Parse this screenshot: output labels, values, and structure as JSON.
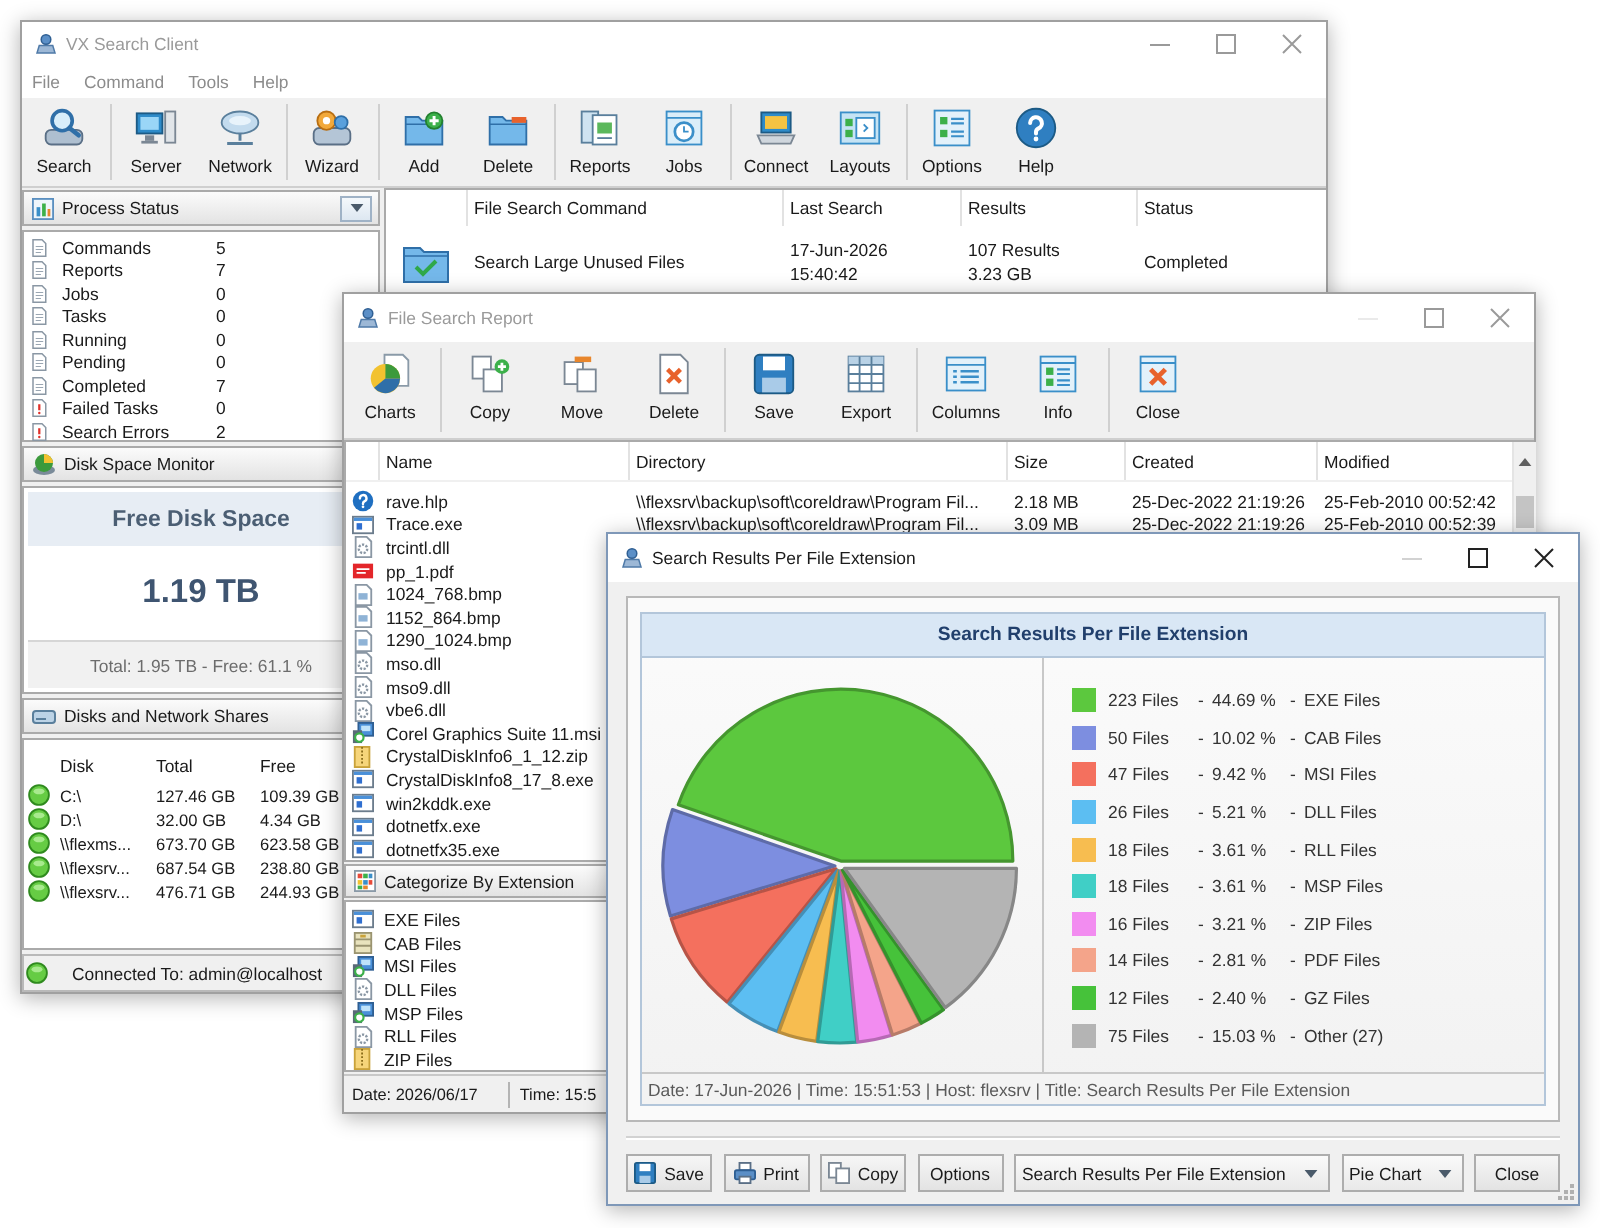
{
  "main_window": {
    "title": "VX Search Client",
    "active": false,
    "minimize_enabled": true,
    "menu": [
      "File",
      "Command",
      "Tools",
      "Help"
    ],
    "toolbar": [
      [
        "Search"
      ],
      [
        "Server",
        "Network"
      ],
      [
        "Wizard"
      ],
      [
        "Add",
        "Delete"
      ],
      [
        "Reports",
        "Jobs"
      ],
      [
        "Connect",
        "Layouts"
      ],
      [
        "Options",
        "Help"
      ]
    ],
    "process_status": {
      "title": "Process Status",
      "items": [
        {
          "kind": "normal",
          "label": "Commands",
          "value": "5"
        },
        {
          "kind": "normal",
          "label": "Reports",
          "value": "7"
        },
        {
          "kind": "normal",
          "label": "Jobs",
          "value": "0"
        },
        {
          "kind": "normal",
          "label": "Tasks",
          "value": "0"
        },
        {
          "kind": "normal",
          "label": "Running",
          "value": "0"
        },
        {
          "kind": "normal",
          "label": "Pending",
          "value": "0"
        },
        {
          "kind": "normal",
          "label": "Completed",
          "value": "7"
        },
        {
          "kind": "error",
          "label": "Failed Tasks",
          "value": "0"
        },
        {
          "kind": "error",
          "label": "Search Errors",
          "value": "2"
        }
      ]
    },
    "disk_monitor": {
      "title": "Disk Space Monitor",
      "heading": "Free Disk Space",
      "free": "1.19 TB",
      "summary": "Total: 1.95 TB - Free: 61.1 %"
    },
    "disks": {
      "title": "Disks and Network Shares",
      "columns": [
        "Disk",
        "Total",
        "Free"
      ],
      "rows": [
        {
          "online": true,
          "cells": [
            "C:\\",
            "127.46 GB",
            "109.39 GB"
          ]
        },
        {
          "online": true,
          "cells": [
            "D:\\",
            "32.00 GB",
            "4.34 GB"
          ]
        },
        {
          "online": true,
          "cells": [
            "\\\\flexms...",
            "673.70 GB",
            "623.58 GB"
          ]
        },
        {
          "online": true,
          "cells": [
            "\\\\flexsrv...",
            "687.54 GB",
            "238.80 GB"
          ]
        },
        {
          "online": true,
          "cells": [
            "\\\\flexsrv...",
            "476.71 GB",
            "244.93 GB"
          ]
        }
      ]
    },
    "status_bar": {
      "online": true,
      "text": "Connected To: admin@localhost"
    },
    "commands": {
      "columns": [
        "File Search Command",
        "Last Search",
        "Results",
        "Status"
      ],
      "rows": [
        {
          "name": "Search Large Unused Files",
          "last_search": [
            "17-Jun-2026",
            "15:40:42"
          ],
          "results": [
            "107 Results",
            "3.23 GB"
          ],
          "status": "Completed"
        }
      ]
    }
  },
  "report_window": {
    "title": "File Search Report",
    "active": false,
    "minimize_enabled": false,
    "toolbar": [
      [
        "Charts"
      ],
      [
        "Copy",
        "Move",
        "Delete"
      ],
      [
        "Save",
        "Export"
      ],
      [
        "Columns",
        "Info"
      ],
      [
        "Close"
      ]
    ],
    "columns": [
      "Name",
      "Directory",
      "Size",
      "Created",
      "Modified"
    ],
    "files": [
      {
        "kind": "help",
        "name": "rave.hlp",
        "directory": "\\\\flexsrv\\backup\\soft\\coreldraw\\Program Fil...",
        "size": "2.18 MB",
        "created": "25-Dec-2022 21:19:26",
        "modified": "25-Feb-2010 00:52:42"
      },
      {
        "kind": "exe",
        "name": "Trace.exe",
        "directory": "\\\\flexsrv\\backup\\soft\\coreldraw\\Program Fil...",
        "size": "3.09 MB",
        "created": "25-Dec-2022 21:19:26",
        "modified": "25-Feb-2010 00:52:39"
      },
      {
        "kind": "dll",
        "name": "trcintl.dll"
      },
      {
        "kind": "pdf",
        "name": "pp_1.pdf"
      },
      {
        "kind": "bmp",
        "name": "1024_768.bmp"
      },
      {
        "kind": "bmp",
        "name": "1152_864.bmp"
      },
      {
        "kind": "bmp",
        "name": "1290_1024.bmp"
      },
      {
        "kind": "dll",
        "name": "mso.dll"
      },
      {
        "kind": "dll",
        "name": "mso9.dll"
      },
      {
        "kind": "dll",
        "name": "vbe6.dll"
      },
      {
        "kind": "msi",
        "name": "Corel Graphics Suite 11.msi"
      },
      {
        "kind": "zip",
        "name": "CrystalDiskInfo6_1_12.zip"
      },
      {
        "kind": "exe",
        "name": "CrystalDiskInfo8_17_8.exe"
      },
      {
        "kind": "exe",
        "name": "win2kddk.exe"
      },
      {
        "kind": "exe",
        "name": "dotnetfx.exe"
      },
      {
        "kind": "exe",
        "name": "dotnetfx35.exe"
      }
    ],
    "categories": {
      "title": "Categorize By Extension",
      "items": [
        {
          "kind": "exe",
          "label": "EXE Files"
        },
        {
          "kind": "cab",
          "label": "CAB Files"
        },
        {
          "kind": "msi",
          "label": "MSI Files"
        },
        {
          "kind": "dll",
          "label": "DLL Files"
        },
        {
          "kind": "msi",
          "label": "MSP Files"
        },
        {
          "kind": "dll",
          "label": "RLL Files"
        },
        {
          "kind": "zip",
          "label": "ZIP Files"
        }
      ]
    },
    "status_bar": [
      "Date: 2026/06/17",
      "Time: 15:5"
    ]
  },
  "chart_window": {
    "title": "Search Results Per File Extension",
    "active": true,
    "minimize_enabled": false,
    "chart_data": {
      "type": "pie",
      "title": "Search Results Per File Extension",
      "values": [
        44.69,
        10.02,
        9.42,
        5.21,
        3.61,
        3.61,
        3.21,
        2.81,
        2.4,
        15.03
      ]
    },
    "legend_separator": "-",
    "legend": [
      {
        "count": "223 Files",
        "percent": "44.69 %",
        "label": "EXE Files",
        "color": "#5cc83e"
      },
      {
        "count": "50 Files",
        "percent": "10.02 %",
        "label": "CAB Files",
        "color": "#7d8ee0"
      },
      {
        "count": "47 Files",
        "percent": "9.42 %",
        "label": "MSI Files",
        "color": "#f4705e"
      },
      {
        "count": "26 Files",
        "percent": "5.21 %",
        "label": "DLL Files",
        "color": "#5cbef2"
      },
      {
        "count": "18 Files",
        "percent": "3.61 %",
        "label": "RLL Files",
        "color": "#f7bd50"
      },
      {
        "count": "18 Files",
        "percent": "3.61 %",
        "label": "MSP Files",
        "color": "#40cfc6"
      },
      {
        "count": "16 Files",
        "percent": "3.21 %",
        "label": "ZIP Files",
        "color": "#f28cf0"
      },
      {
        "count": "14 Files",
        "percent": "2.81 %",
        "label": "PDF Files",
        "color": "#f4a48a"
      },
      {
        "count": "12 Files",
        "percent": "2.40 %",
        "label": "GZ Files",
        "color": "#46c23a"
      },
      {
        "count": "75 Files",
        "percent": "15.03 %",
        "label": "Other (27)",
        "color": "#b4b4b4"
      }
    ],
    "footer": "Date: 17-Jun-2026 | Time: 15:51:53 | Host: flexsrv | Title: Search Results Per File Extension",
    "controls": [
      {
        "kind": "button",
        "label": "Save"
      },
      {
        "kind": "button",
        "label": "Print"
      },
      {
        "kind": "button",
        "label": "Copy"
      },
      {
        "kind": "button",
        "label": "Options"
      },
      {
        "kind": "select",
        "value": "Search Results Per File Extension"
      },
      {
        "kind": "select",
        "value": "Pie Chart"
      },
      {
        "kind": "button",
        "label": "Close"
      }
    ]
  }
}
